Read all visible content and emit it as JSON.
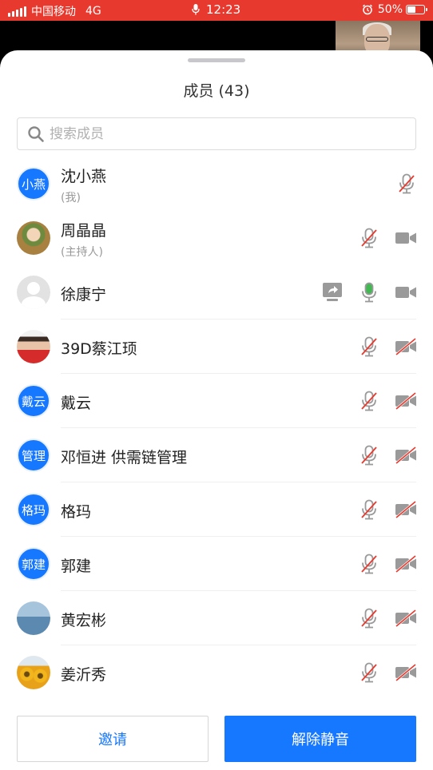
{
  "status_bar": {
    "carrier": "中国移动",
    "network": "4G",
    "time": "12:23",
    "battery": "50%",
    "battery_level": 0.5,
    "icons": [
      "signal-icon",
      "microphone-icon",
      "alarm-icon",
      "battery-icon"
    ]
  },
  "sheet": {
    "title": "成员 (43)",
    "search_placeholder": "搜索成员"
  },
  "members": [
    {
      "name": "沈小燕",
      "subtitle": "(我)",
      "avatar_text": "小燕",
      "avatar": "text",
      "mic": "muted",
      "camera": "none",
      "sharing": false
    },
    {
      "name": "周晶晶",
      "subtitle": "(主持人)",
      "avatar_text": "",
      "avatar": "photo-child-in-nest",
      "mic": "muted",
      "camera": "on",
      "sharing": false
    },
    {
      "name": "徐康宁",
      "subtitle": "",
      "avatar_text": "",
      "avatar": "default-person",
      "mic": "active",
      "camera": "on",
      "sharing": true
    },
    {
      "name": "39D蔡江顼",
      "subtitle": "",
      "avatar_text": "",
      "avatar": "photo-woman",
      "mic": "muted",
      "camera": "off",
      "sharing": false
    },
    {
      "name": "戴云",
      "subtitle": "",
      "avatar_text": "戴云",
      "avatar": "text",
      "mic": "muted",
      "camera": "off",
      "sharing": false
    },
    {
      "name": "邓恒进 供需链管理",
      "subtitle": "",
      "avatar_text": "管理",
      "avatar": "text",
      "mic": "muted",
      "camera": "off",
      "sharing": false
    },
    {
      "name": "格玛",
      "subtitle": "",
      "avatar_text": "格玛",
      "avatar": "text",
      "mic": "muted",
      "camera": "off",
      "sharing": false
    },
    {
      "name": "郭建",
      "subtitle": "",
      "avatar_text": "郭建",
      "avatar": "text",
      "mic": "muted",
      "camera": "off",
      "sharing": false
    },
    {
      "name": "黄宏彬",
      "subtitle": "",
      "avatar_text": "",
      "avatar": "photo-sea-boat",
      "mic": "muted",
      "camera": "off",
      "sharing": false
    },
    {
      "name": "姜沂秀",
      "subtitle": "",
      "avatar_text": "",
      "avatar": "photo-sunflowers",
      "mic": "muted",
      "camera": "off",
      "sharing": false
    }
  ],
  "buttons": {
    "invite": "邀请",
    "unmute_all": "解除静音"
  },
  "colors": {
    "status_bar": "#e8392e",
    "accent": "#1677ff",
    "mic_active": "#3fb950",
    "muted_slash": "#e8392e",
    "icon_gray": "#9a9a9a"
  }
}
